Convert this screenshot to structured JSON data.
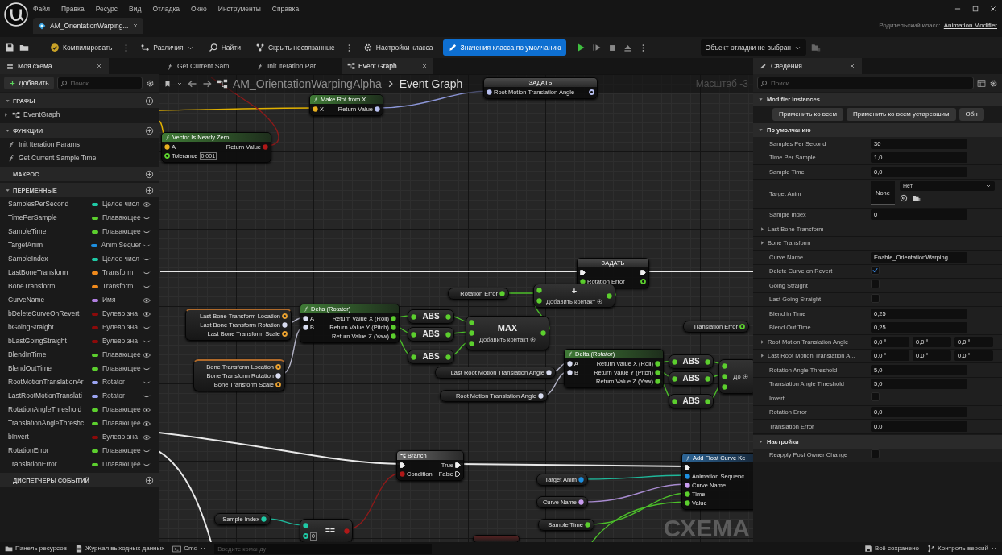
{
  "window": {
    "tab": "AM_OrientationWarping...",
    "parent_class_label": "Родительский класс:",
    "parent_class": "Animation Modifier"
  },
  "menu": [
    "Файл",
    "Правка",
    "Ресурс",
    "Вид",
    "Отладка",
    "Окно",
    "Инструменты",
    "Справка"
  ],
  "toolbar": {
    "buttons": [
      {
        "kind": "compile",
        "label": "Компилировать",
        "selected": false
      },
      {
        "kind": "diff",
        "label": "Различия",
        "selected": false
      },
      {
        "kind": "find",
        "label": "Найти",
        "selected": false
      },
      {
        "kind": "hide",
        "label": "Скрыть несвязанные",
        "selected": false
      },
      {
        "kind": "settings",
        "label": "Настройки класса",
        "selected": false
      },
      {
        "kind": "defaults",
        "label": "Значения класса по умолчанию",
        "selected": true
      }
    ],
    "debug_object": "Объект отладки не выбран"
  },
  "my_blueprint": {
    "tab": "Моя схема",
    "add": "Добавить",
    "search_placeholder": "Поиск",
    "sections": [
      {
        "kind": "graphs",
        "title": "ГРАФЫ",
        "expanded": true,
        "items": [
          {
            "label": "EventGraph",
            "expanded": false
          }
        ]
      },
      {
        "kind": "functions",
        "title": "ФУНКЦИИ",
        "expanded": true,
        "items": [
          {
            "label": "Init Iteration Params"
          },
          {
            "label": "Get Current Sample Time"
          }
        ]
      },
      {
        "title": "МАКРОС",
        "expanded": false
      },
      {
        "kind": "variables",
        "title": "ПЕРЕМЕННЫЕ",
        "expanded": true,
        "items": [
          {
            "name": "SamplesPerSecond",
            "type": "Целое числ",
            "color": "#1fc9a5",
            "public": true
          },
          {
            "name": "TimePerSample",
            "type": "Плавающее",
            "color": "#5ccf2e",
            "public": false
          },
          {
            "name": "SampleTime",
            "type": "Плавающее",
            "color": "#5ccf2e",
            "public": false
          },
          {
            "name": "TargetAnim",
            "type": "Anim Sequer",
            "color": "#1d8fe0",
            "public": false
          },
          {
            "name": "SampleIndex",
            "type": "Целое числ",
            "color": "#1fc9a5",
            "public": false
          },
          {
            "name": "LastBoneTransform",
            "type": "Transform",
            "color": "#f08a1c",
            "public": false
          },
          {
            "name": "BoneTransform",
            "type": "Transform",
            "color": "#f08a1c",
            "public": false
          },
          {
            "name": "CurveName",
            "type": "Имя",
            "color": "#b07fe0",
            "public": true
          },
          {
            "name": "bDeleteCurveOnRevert",
            "type": "Булево зна",
            "color": "#8c0a0a",
            "public": true
          },
          {
            "name": "bGoingStraight",
            "type": "Булево зна",
            "color": "#8c0a0a",
            "public": false
          },
          {
            "name": "bLastGoingStraight",
            "type": "Булево зна",
            "color": "#8c0a0a",
            "public": false
          },
          {
            "name": "BlendInTime",
            "type": "Плавающее",
            "color": "#5ccf2e",
            "public": true
          },
          {
            "name": "BlendOutTime",
            "type": "Плавающее",
            "color": "#5ccf2e",
            "public": false
          },
          {
            "name": "RootMotionTranslationAr",
            "type": "Rotator",
            "color": "#9aa3f0",
            "public": false
          },
          {
            "name": "LastRootMotionTranslati",
            "type": "Rotator",
            "color": "#9aa3f0",
            "public": false
          },
          {
            "name": "RotationAngleThreshold",
            "type": "Плавающее",
            "color": "#5ccf2e",
            "public": true
          },
          {
            "name": "TranslationAngleThreshc",
            "type": "Плавающее",
            "color": "#5ccf2e",
            "public": true
          },
          {
            "name": "bInvert",
            "type": "Булево зна",
            "color": "#8c0a0a",
            "public": true
          },
          {
            "name": "RotationError",
            "type": "Плавающее",
            "color": "#5ccf2e",
            "public": false
          },
          {
            "name": "TranslationError",
            "type": "Плавающее",
            "color": "#5ccf2e",
            "public": false
          }
        ]
      },
      {
        "title": "ДИСПЕТЧЕРЫ СОБЫТИЙ",
        "expanded": false
      }
    ]
  },
  "graph_tabs": [
    {
      "kind": "function",
      "label": "Get Current Sam...",
      "selected": false
    },
    {
      "kind": "function",
      "label": "Init Iteration Par...",
      "selected": false
    },
    {
      "kind": "graph",
      "label": "Event Graph",
      "selected": true
    }
  ],
  "graph": {
    "path": [
      "AM_OrientationWarpingAlpha",
      "Event Graph"
    ],
    "zoom": "Масштаб -3",
    "watermark": "СХЕМА",
    "nodes": [
      {
        "kind": "set",
        "title": "ЗАДАТЬ",
        "inputs": [
          {
            "label": "Root Motion Translation Angle",
            "kind": "data",
            "color": "#b8c0f0",
            "linked": true
          }
        ],
        "outputs": [
          {
            "kind": "data",
            "color": "#b8c0f0",
            "linked": false
          }
        ]
      },
      {
        "kind": "function",
        "title": "Make Rot from X",
        "inputs": [
          {
            "label": "X",
            "kind": "data",
            "color": "#e8b020",
            "linked": true
          }
        ],
        "outputs": [
          {
            "label": "Return Value",
            "kind": "data",
            "color": "#b8c0f0",
            "linked": true
          }
        ]
      },
      {
        "kind": "function",
        "title": "Vector Is Nearly Zero",
        "inputs": [
          {
            "label": "A",
            "kind": "data",
            "color": "#e8b020",
            "linked": true
          },
          {
            "label": "Tolerance",
            "kind": "data",
            "color": "#5ccf2e",
            "linked": false,
            "value": "0,001"
          }
        ],
        "outputs": [
          {
            "label": "Return Value",
            "kind": "data",
            "color": "#b01818",
            "linked": true
          }
        ]
      },
      {
        "kind": "set",
        "title": "ЗАДАТЬ",
        "inputs": [
          {
            "kind": "exec",
            "linked": true
          },
          {
            "label": "Rotation Error",
            "kind": "data",
            "color": "#5ccf2e",
            "linked": true
          }
        ],
        "outputs": [
          {
            "kind": "exec",
            "linked": true
          },
          {
            "kind": "data",
            "color": "#5ccf2e",
            "linked": false
          }
        ]
      },
      {
        "kind": "get",
        "outputs": [
          {
            "label": "Rotation Error",
            "kind": "data",
            "color": "#5ccf2e",
            "linked": true
          }
        ]
      },
      {
        "kind": "operator",
        "op": "+",
        "inputs": [
          {
            "kind": "data",
            "color": "#5ccf2e",
            "linked": true
          },
          {
            "kind": "data",
            "color": "#5ccf2e",
            "linked": true
          }
        ],
        "outputs": [
          {
            "kind": "data",
            "color": "#5ccf2e",
            "linked": true
          }
        ],
        "add_pin": "Добавить контакт"
      },
      {
        "kind": "break",
        "outputs": [
          {
            "label": "Last Bone Transform Location",
            "kind": "data",
            "color": "#e8a030",
            "linked": false
          },
          {
            "label": "Last Bone Transform Rotation",
            "kind": "data",
            "color": "#d8dcf0",
            "linked": true
          },
          {
            "label": "Last Bone Transform Scale",
            "kind": "data",
            "color": "#e8a030",
            "linked": false
          }
        ]
      },
      {
        "kind": "function",
        "title": "Delta (Rotator)",
        "inputs": [
          {
            "label": "A",
            "kind": "data",
            "color": "#d8dcf0",
            "linked": true
          },
          {
            "label": "B",
            "kind": "data",
            "color": "#d8dcf0",
            "linked": true
          }
        ],
        "outputs": [
          {
            "label": "Return Value X (Roll)",
            "kind": "data",
            "color": "#5ccf2e",
            "linked": true
          },
          {
            "label": "Return Value Y (Pitch)",
            "kind": "data",
            "color": "#5ccf2e",
            "linked": true
          },
          {
            "label": "Return Value Z (Yaw)",
            "kind": "data",
            "color": "#5ccf2e",
            "linked": true
          }
        ]
      },
      {
        "kind": "operator",
        "op": "ABS",
        "inputs": [
          {
            "kind": "data",
            "color": "#5ccf2e",
            "linked": true
          }
        ],
        "outputs": [
          {
            "kind": "data",
            "color": "#5ccf2e",
            "linked": true
          }
        ]
      },
      {
        "kind": "operator",
        "op": "ABS",
        "inputs": [
          {
            "kind": "data",
            "color": "#5ccf2e",
            "linked": true
          }
        ],
        "outputs": [
          {
            "kind": "data",
            "color": "#5ccf2e",
            "linked": true
          }
        ]
      },
      {
        "kind": "operator",
        "op": "ABS",
        "inputs": [
          {
            "kind": "data",
            "color": "#5ccf2e",
            "linked": true
          }
        ],
        "outputs": [
          {
            "kind": "data",
            "color": "#5ccf2e",
            "linked": true
          }
        ]
      },
      {
        "kind": "operator",
        "op": "MAX",
        "inputs": [
          {
            "kind": "data",
            "color": "#5ccf2e",
            "linked": true
          },
          {
            "kind": "data",
            "color": "#5ccf2e",
            "linked": true
          },
          {
            "kind": "data",
            "color": "#5ccf2e",
            "linked": true
          }
        ],
        "outputs": [
          {
            "kind": "data",
            "color": "#5ccf2e",
            "linked": true
          }
        ],
        "add_pin": "Добавить контакт"
      },
      {
        "kind": "get",
        "outputs": [
          {
            "label": "Translation Error",
            "kind": "data",
            "color": "#5ccf2e",
            "linked": false
          }
        ]
      },
      {
        "kind": "break",
        "outputs": [
          {
            "label": "Bone Transform Location",
            "kind": "data",
            "color": "#e8a030",
            "linked": false
          },
          {
            "label": "Bone Transform Rotation",
            "kind": "data",
            "color": "#d8dcf0",
            "linked": true
          },
          {
            "label": "Bone Transform Scale",
            "kind": "data",
            "color": "#e8a030",
            "linked": false
          }
        ]
      },
      {
        "kind": "get",
        "outputs": [
          {
            "label": "Last Root Motion Translation Angle",
            "kind": "data",
            "color": "#d8dcf0",
            "linked": true
          }
        ]
      },
      {
        "kind": "function",
        "title": "Delta (Rotator)",
        "inputs": [
          {
            "label": "A",
            "kind": "data",
            "color": "#d8dcf0",
            "linked": true
          },
          {
            "label": "B",
            "kind": "data",
            "color": "#d8dcf0",
            "linked": true
          }
        ],
        "outputs": [
          {
            "label": "Return Value X (Roll)",
            "kind": "data",
            "color": "#5ccf2e",
            "linked": true
          },
          {
            "label": "Return Value Y (Pitch)",
            "kind": "data",
            "color": "#5ccf2e",
            "linked": true
          },
          {
            "label": "Return Value Z (Yaw)",
            "kind": "data",
            "color": "#5ccf2e",
            "linked": true
          }
        ]
      },
      {
        "kind": "operator",
        "op": "ABS",
        "inputs": [
          {
            "kind": "data",
            "color": "#5ccf2e",
            "linked": true
          }
        ],
        "outputs": [
          {
            "kind": "data",
            "color": "#5ccf2e",
            "linked": true
          }
        ]
      },
      {
        "kind": "operator",
        "op": "ABS",
        "inputs": [
          {
            "kind": "data",
            "color": "#5ccf2e",
            "linked": true
          }
        ],
        "outputs": [
          {
            "kind": "data",
            "color": "#5ccf2e",
            "linked": true
          }
        ]
      },
      {
        "kind": "operator",
        "op": "ABS",
        "inputs": [
          {
            "kind": "data",
            "color": "#5ccf2e",
            "linked": true
          }
        ],
        "outputs": [
          {
            "kind": "data",
            "color": "#5ccf2e",
            "linked": true
          }
        ]
      },
      {
        "kind": "operator",
        "inputs": [
          {
            "kind": "data",
            "color": "#5ccf2e",
            "linked": true
          },
          {
            "kind": "data",
            "color": "#5ccf2e",
            "linked": true
          },
          {
            "kind": "data",
            "color": "#5ccf2e",
            "linked": true
          }
        ],
        "add_pin": "До"
      },
      {
        "kind": "get",
        "outputs": [
          {
            "label": "Root Motion Translation Angle",
            "kind": "data",
            "color": "#d8dcf0",
            "linked": true
          }
        ]
      },
      {
        "kind": "branch",
        "title": "Branch",
        "inputs": [
          {
            "kind": "exec",
            "linked": true
          },
          {
            "label": "Condition",
            "kind": "data",
            "color": "#b01818",
            "linked": true
          }
        ],
        "outputs": [
          {
            "label": "True",
            "kind": "exec",
            "linked": true
          },
          {
            "label": "False",
            "kind": "exec",
            "linked": false
          }
        ]
      },
      {
        "kind": "get",
        "outputs": [
          {
            "label": "Target Anim",
            "kind": "data",
            "color": "#1d8fe0",
            "linked": true
          }
        ]
      },
      {
        "kind": "get",
        "outputs": [
          {
            "label": "Curve Name",
            "kind": "data",
            "color": "#c89cf0",
            "linked": true
          }
        ]
      },
      {
        "kind": "get",
        "outputs": [
          {
            "label": "Sample Time",
            "kind": "data",
            "color": "#5ccf2e",
            "linked": true
          }
        ]
      },
      {
        "kind": "call",
        "title": "Add Float Curve Ke",
        "inputs": [
          {
            "kind": "exec",
            "linked": true
          },
          {
            "label": "Animation Sequenc",
            "kind": "data",
            "color": "#1d8fe0",
            "linked": true
          },
          {
            "label": "Curve Name",
            "kind": "data",
            "color": "#c89cf0",
            "linked": true
          },
          {
            "label": "Time",
            "kind": "data",
            "color": "#5ccf2e",
            "linked": true
          },
          {
            "label": "Value",
            "kind": "data",
            "color": "#5ccf2e",
            "linked": true
          }
        ]
      },
      {
        "kind": "get",
        "outputs": [
          {
            "label": "Sample Index",
            "kind": "data",
            "color": "#1fc9a5",
            "linked": true
          }
        ]
      },
      {
        "kind": "operator",
        "op": "==",
        "inputs": [
          {
            "kind": "data",
            "color": "#1fc9a5",
            "linked": true
          },
          {
            "kind": "data",
            "color": "#1fc9a5",
            "linked": false,
            "value": "0"
          }
        ],
        "outputs": [
          {
            "kind": "data",
            "color": "#b01818",
            "linked": true
          }
        ]
      },
      {
        "kind": "stub"
      }
    ]
  },
  "details": {
    "tab": "Сведения",
    "search_placeholder": "Поиск",
    "sections": [
      {
        "title": "Modifier Instances",
        "expanded": true,
        "buttons": [
          "Применить ко всем",
          "Применить ко всем устаревшим",
          "Обн"
        ]
      },
      {
        "title": "По умолчанию",
        "expanded": true,
        "rows": [
          {
            "kind": "number",
            "label": "Samples Per Second",
            "value": "30"
          },
          {
            "kind": "number",
            "label": "Time Per Sample",
            "value": "1,0"
          },
          {
            "kind": "number",
            "label": "Sample Time",
            "value": "0,0"
          },
          {
            "kind": "asset",
            "label": "Target Anim",
            "thumbnail": "None",
            "value": "Нет"
          },
          {
            "kind": "number",
            "label": "Sample Index",
            "value": "0"
          },
          {
            "kind": "struct",
            "label": "Last Bone Transform",
            "expanded": false
          },
          {
            "kind": "struct",
            "label": "Bone Transform",
            "expanded": false
          },
          {
            "kind": "text",
            "label": "Curve Name",
            "value": "Enable_OrientationWarping"
          },
          {
            "kind": "check",
            "label": "Delete Curve on Revert",
            "checked": true
          },
          {
            "kind": "check",
            "label": "Going Straight",
            "checked": false
          },
          {
            "kind": "check",
            "label": "Last Going Straight",
            "checked": false
          },
          {
            "kind": "number",
            "label": "Blend in Time",
            "value": "0,25"
          },
          {
            "kind": "number",
            "label": "Blend Out Time",
            "value": "0,25"
          },
          {
            "kind": "triple",
            "label": "Root Motion Translation Angle",
            "expanded": false,
            "values": [
              "0,0 °",
              "0,0 °",
              "0,0 °"
            ]
          },
          {
            "kind": "triple",
            "label": "Last Root Motion Translation A...",
            "expanded": false,
            "values": [
              "0,0 °",
              "0,0 °",
              "0,0 °"
            ]
          },
          {
            "kind": "number",
            "label": "Rotation Angle Threshold",
            "value": "5,0"
          },
          {
            "kind": "number",
            "label": "Translation Angle Threshold",
            "value": "5,0"
          },
          {
            "kind": "check",
            "label": "Invert",
            "checked": false
          },
          {
            "kind": "number",
            "label": "Rotation Error",
            "value": "0,0"
          },
          {
            "kind": "number",
            "label": "Translation Error",
            "value": "0,0"
          }
        ]
      },
      {
        "title": "Настройки",
        "expanded": true,
        "rows": [
          {
            "kind": "check",
            "label": "Reapply Post Owner Change",
            "checked": false
          }
        ]
      }
    ]
  },
  "status_bar": {
    "left": [
      {
        "kind": "content",
        "label": "Панель ресурсов"
      },
      {
        "kind": "log",
        "label": "Журнал выходных данных"
      }
    ],
    "cmd": "Cmd",
    "cmd_placeholder": "Введите команду",
    "right": [
      {
        "kind": "saved",
        "label": "Всё сохранено"
      },
      {
        "kind": "vcs",
        "label": "Контроль версий"
      }
    ]
  }
}
